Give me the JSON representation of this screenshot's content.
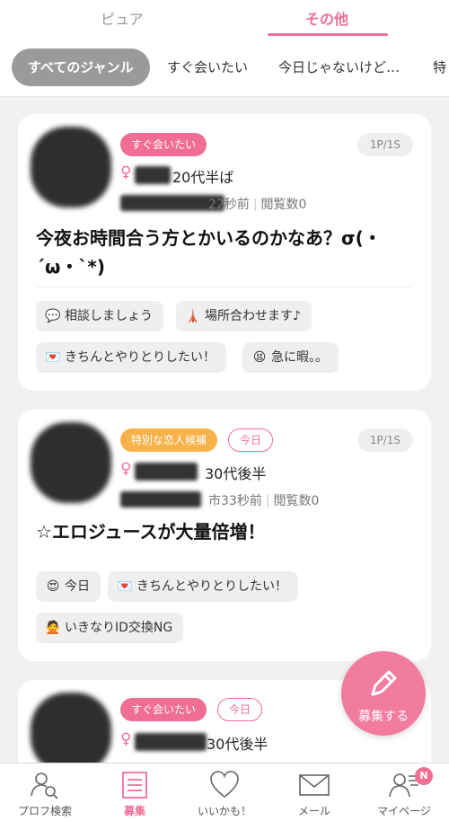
{
  "tabs": {
    "left": "ピュア",
    "right": "その他"
  },
  "genres": [
    "すべてのジャンル",
    "すぐ会いたい",
    "今日じゃないけど…",
    "特"
  ],
  "cards": [
    {
      "badges": [
        "すぐ会いたい"
      ],
      "page": "1P/1S",
      "gender": "♀",
      "age": "20代半ば",
      "time": "22秒前",
      "views": "閲覧数0",
      "title": "今夜お時間合う方とかいるのかなあ？σ(・´ω・`*)",
      "tags": [
        {
          "icon": "speech-bubble-icon",
          "text": "相談しましょう"
        },
        {
          "icon": "tower-icon",
          "text": "場所合わせます♪"
        },
        {
          "icon": "love-letter-icon",
          "text": "きちんとやりとりしたい！"
        },
        {
          "icon": "tired-face-icon",
          "text": "急に暇。。"
        }
      ]
    },
    {
      "badges": [
        "特別な恋人候補",
        "今日"
      ],
      "page": "1P/1S",
      "gender": "♀",
      "age": "30代後半",
      "city_suffix": "市",
      "time": "33秒前",
      "views": "閲覧数0",
      "title": "☆エロジュースが大量倍増！",
      "tags": [
        {
          "icon": "heart-eyes-icon",
          "text": "今日"
        },
        {
          "icon": "love-letter-icon",
          "text": "きちんとやりとりしたい！"
        },
        {
          "icon": "no-gesture-icon",
          "text": "いきなりID交換NG"
        }
      ]
    },
    {
      "badges": [
        "すぐ会いたい",
        "今日"
      ],
      "gender": "♀",
      "age": "30代後半"
    }
  ],
  "fab": {
    "label": "募集する"
  },
  "nav": [
    {
      "label": "プロフ検索"
    },
    {
      "label": "募集"
    },
    {
      "label": "いいかも！"
    },
    {
      "label": "メール"
    },
    {
      "label": "マイページ",
      "badge": "N"
    }
  ],
  "colors": {
    "accent": "#f06e96",
    "badge_orange": "#f7b24a",
    "chip_active": "#9a9a9a"
  }
}
